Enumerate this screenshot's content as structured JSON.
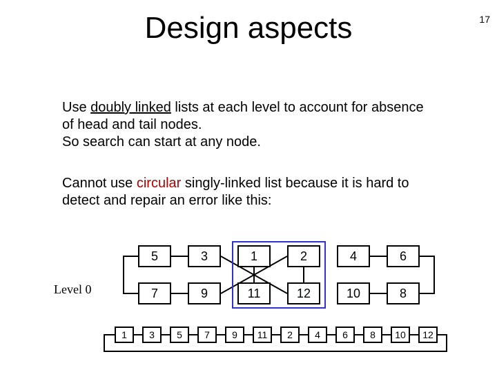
{
  "page_number": "17",
  "title": "Design aspects",
  "paragraph1_prefix": "Use ",
  "paragraph1_underlined": "doubly linked",
  "paragraph1_rest": " lists at each level to account for absence of head and tail nodes.\nSo search can start at any node.",
  "paragraph2_prefix": "Cannot use ",
  "paragraph2_red": "circular",
  "paragraph2_rest": " singly-linked list because it is hard to detect and repair an error like this:",
  "level_label": "Level 0",
  "row_top": [
    "5",
    "3",
    "1",
    "2",
    "4",
    "6"
  ],
  "row_mid": [
    "7",
    "9",
    "11",
    "12",
    "10",
    "8"
  ],
  "row_bottom": [
    "1",
    "3",
    "5",
    "7",
    "9",
    "11",
    "2",
    "4",
    "6",
    "8",
    "10",
    "12"
  ]
}
